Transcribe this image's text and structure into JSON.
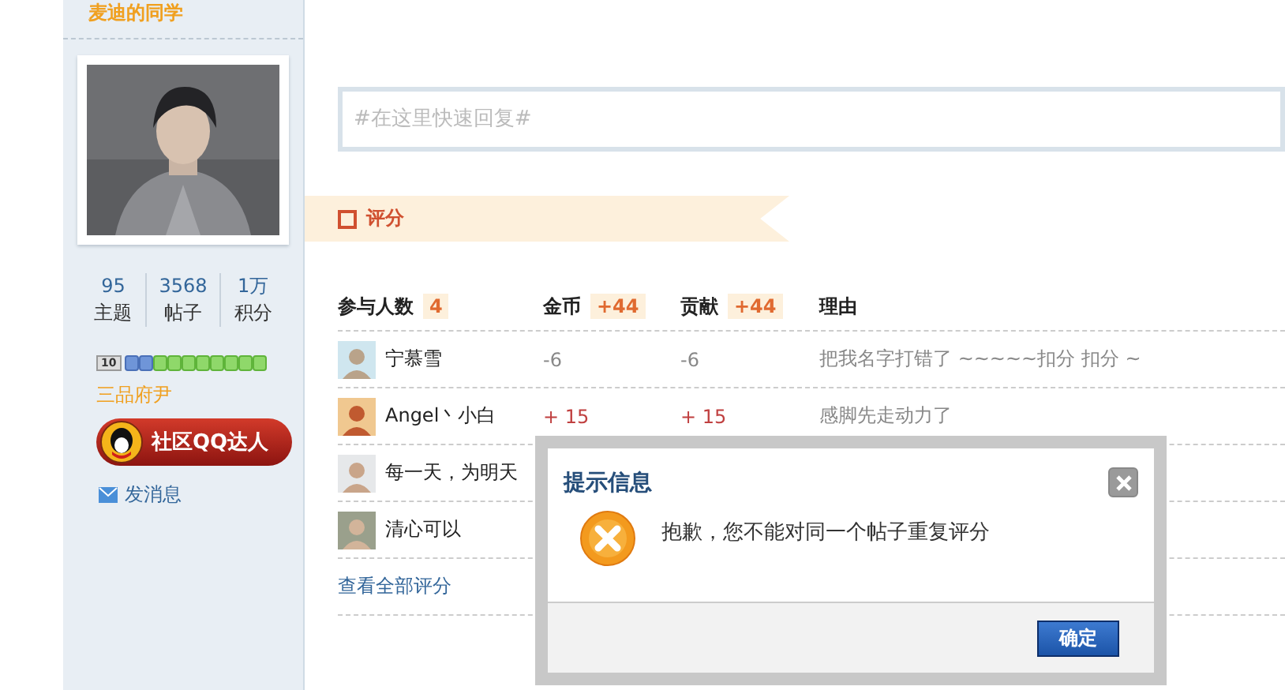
{
  "profile": {
    "name": "麦迪的同学",
    "kind": "picture",
    "stats": [
      {
        "value": "95",
        "label": "主题"
      },
      {
        "value": "3568",
        "label": "帖子"
      },
      {
        "value": "1万",
        "label": "积分"
      }
    ],
    "level_badge": "10",
    "rank": "三品府尹",
    "medal": "社区QQ达人",
    "message_link": "发消息"
  },
  "reply": {
    "placeholder": "#在这里快速回复#"
  },
  "rating": {
    "title": "评分",
    "columns": [
      {
        "label": "参与人数",
        "badge": "4"
      },
      {
        "label": "金币",
        "badge": "+44"
      },
      {
        "label": "贡献",
        "badge": "+44"
      },
      {
        "label": "理由"
      }
    ],
    "rows": [
      {
        "user": "宁慕雪",
        "gold": "-6",
        "contribution": "-6",
        "reason": "把我名字打错了 ~~~~~扣分 扣分 ~"
      },
      {
        "user": "Angel丶小白",
        "gold": "+ 15",
        "contribution": "+ 15",
        "reason": "感脚先走动力了"
      },
      {
        "user": "每一天，为明天"
      },
      {
        "user": "清心可以"
      }
    ],
    "view_all": "查看全部评分"
  },
  "dialog": {
    "title": "提示信息",
    "message": "抱歉，您不能对同一个帖子重复评分",
    "buttons": [
      "确定"
    ]
  }
}
